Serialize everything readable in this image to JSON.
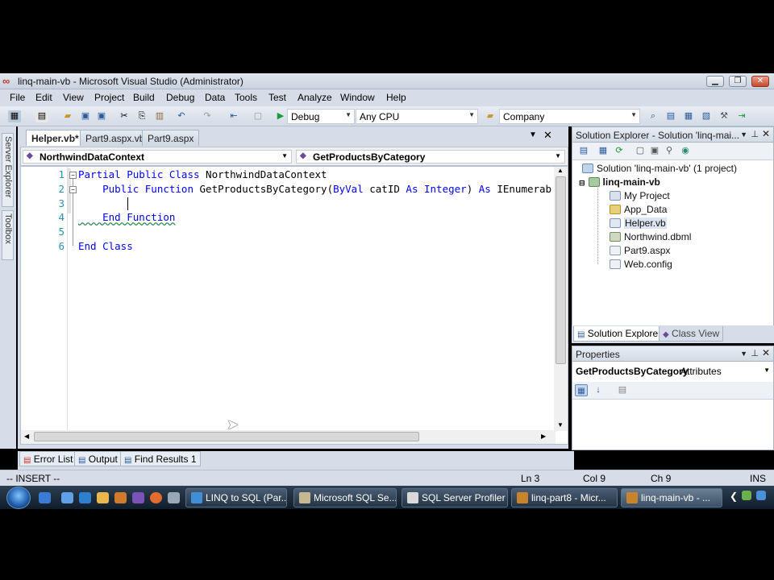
{
  "window": {
    "title": "linq-main-vb - Microsoft Visual Studio (Administrator)",
    "buttons": [
      "minimize",
      "maximize",
      "close"
    ]
  },
  "menu": [
    "File",
    "Edit",
    "View",
    "Project",
    "Build",
    "Debug",
    "Data",
    "Tools",
    "Test",
    "Analyze",
    "Window",
    "Help"
  ],
  "toolbar": {
    "config": "Debug",
    "platform": "Any CPU",
    "find_combo": "Company"
  },
  "left_strip": [
    "Server Explorer",
    "Toolbox"
  ],
  "editor": {
    "tabs": [
      {
        "label": "Helper.vb*",
        "active": true
      },
      {
        "label": "Part9.aspx.vb",
        "active": false
      },
      {
        "label": "Part9.aspx",
        "active": false
      }
    ],
    "class_combo": "NorthwindDataContext",
    "member_combo": "GetProductsByCategory",
    "lines": [
      {
        "n": "1",
        "parts": [
          {
            "t": "Partial Public Class",
            "c": "kw"
          },
          {
            "t": " NorthwindDataContext",
            "c": ""
          }
        ]
      },
      {
        "n": "2",
        "parts": [
          {
            "t": "    Public Function",
            "c": "kw"
          },
          {
            "t": " GetProductsByCategory(",
            "c": ""
          },
          {
            "t": "ByVal",
            "c": "kw"
          },
          {
            "t": " catID ",
            "c": ""
          },
          {
            "t": "As Integer",
            "c": "kw"
          },
          {
            "t": ") ",
            "c": ""
          },
          {
            "t": "As",
            "c": "kw"
          },
          {
            "t": " IEnumerab:",
            "c": ""
          }
        ]
      },
      {
        "n": "3",
        "parts": [
          {
            "t": "        ",
            "c": ""
          }
        ]
      },
      {
        "n": "4",
        "parts": [
          {
            "t": "    End Function",
            "c": "kw squig"
          }
        ]
      },
      {
        "n": "5",
        "parts": [
          {
            "t": "",
            "c": ""
          }
        ]
      },
      {
        "n": "6",
        "parts": [
          {
            "t": "End Class",
            "c": "kw"
          }
        ]
      }
    ]
  },
  "solution_explorer": {
    "header": "Solution Explorer - Solution 'linq-mai...",
    "solution": "Solution 'linq-main-vb' (1 project)",
    "project": "linq-main-vb",
    "items": [
      "My Project",
      "App_Data",
      "Helper.vb",
      "Northwind.dbml",
      "Part9.aspx",
      "Web.config"
    ],
    "tabs": [
      "Solution Explorer",
      "Class View"
    ]
  },
  "properties": {
    "header": "Properties",
    "object": "GetProductsByCategory",
    "object_type": "Attributes"
  },
  "output_tabs": [
    "Error List",
    "Output",
    "Find Results 1"
  ],
  "status": {
    "mode": "-- INSERT --",
    "ln": "Ln 3",
    "col": "Col 9",
    "ch": "Ch 9",
    "ins": "INS"
  },
  "taskbar": {
    "buttons": [
      {
        "label": "LINQ to SQL (Par...",
        "icon": "ie-icon"
      },
      {
        "label": "Microsoft SQL Se...",
        "icon": "sql-icon"
      },
      {
        "label": "SQL Server Profiler",
        "icon": "profiler-icon"
      },
      {
        "label": "linq-part8 - Micr...",
        "icon": "vs-icon"
      },
      {
        "label": "linq-main-vb - ...",
        "icon": "vs-icon",
        "active": true
      }
    ]
  }
}
